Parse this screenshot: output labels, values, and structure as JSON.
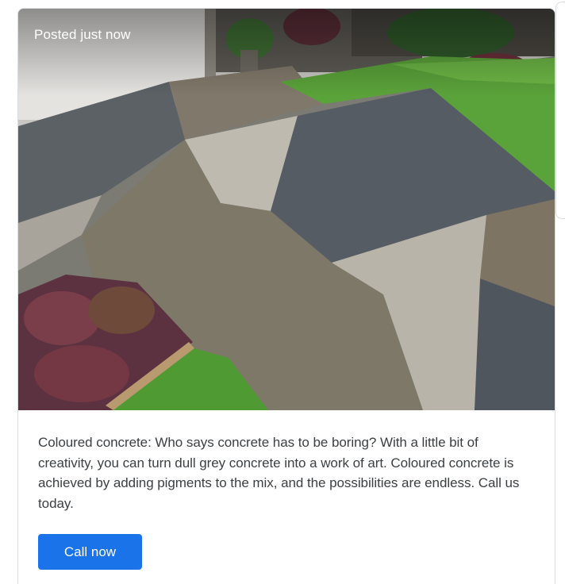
{
  "post": {
    "timestamp": "Posted just now",
    "text": "Coloured concrete: Who says concrete has to be boring? With a little bit of creativity, you can turn dull grey concrete into a work of art. Coloured concrete is achieved by adding pigments to the mix, and the possibilities are endless. Call us today.",
    "cta_label": "Call now",
    "photo_subject": "coloured concrete driveway with grey, charcoal and brown geometric panels beside a lawn and garden bed"
  },
  "colors": {
    "accent": "#1a73e8",
    "text": "#3c4043",
    "border": "#dadce0"
  }
}
